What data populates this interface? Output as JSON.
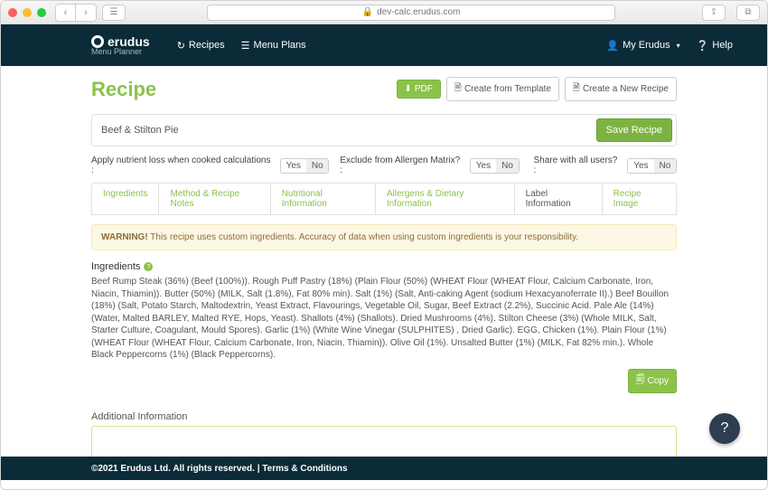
{
  "browser": {
    "url": "dev-calc.erudus.com"
  },
  "header": {
    "brand": "erudus",
    "sub": "Menu Planner",
    "nav": {
      "recipes": "Recipes",
      "menu_plans": "Menu Plans"
    },
    "user_menu": "My Erudus",
    "help": "Help"
  },
  "page": {
    "title": "Recipe",
    "actions": {
      "pdf": "PDF",
      "from_template": "Create from Template",
      "new_recipe": "Create a New Recipe"
    },
    "recipe_name": "Beef & Stilton Pie",
    "save_label": "Save Recipe",
    "options": {
      "nutrient_loss_label": "Apply nutrient loss when cooked calculations :",
      "exclude_allergen_label": "Exclude from Allergen Matrix? :",
      "share_label": "Share with all users? :",
      "yes": "Yes",
      "no": "No"
    },
    "tabs": [
      "Ingredients",
      "Method & Recipe Notes",
      "Nutritional Information",
      "Allergens & Dietary Information",
      "Label Information",
      "Recipe Image"
    ],
    "active_tab_index": 4,
    "warning_prefix": "WARNING!",
    "warning_text": " This recipe uses custom ingredients. Accuracy of data when using custom ingredients is your responsibility.",
    "ingredients_title": "Ingredients",
    "ingredients_text": "Beef Rump Steak (36%) (Beef (100%)). Rough Puff Pastry (18%) (Plain Flour (50%) (WHEAT Flour (WHEAT Flour, Calcium Carbonate, Iron, Niacin, Thiamin)). Butter (50%) (MILK, Salt (1.8%), Fat 80% min). Salt (1%) (Salt, Anti-caking Agent (sodium Hexacyanoferrate II).) Beef Bouillon (18%) (Salt, Potato Starch, Maltodextrin, Yeast Extract, Flavourings, Vegetable Oil, Sugar, Beef Extract (2.2%), Succinic Acid. Pale Ale (14%) (Water, Malted BARLEY, Malted RYE, Hops, Yeast). Shallots (4%) (Shallots). Dried Mushrooms (4%). Stilton Cheese (3%) (Whole MILK, Salt, Starter Culture, Coagulant, Mould Spores). Garlic (1%) (White Wine Vinegar (SULPHITES) , Dried Garlic). EGG, Chicken (1%). Plain Flour (1%) (WHEAT Flour (WHEAT Flour, Calcium Carbonate, Iron, Niacin, Thiamin)). Olive Oil (1%). Unsalted Butter (1%) (MILK, Fat 82% min.). Whole Black Peppercorns (1%) (Black Peppercorns).",
    "copy_label": "Copy",
    "addl_title": "Additional Information",
    "addl_value": ""
  },
  "footer": {
    "copyright": "©2021 Erudus Ltd. All rights reserved. |",
    "terms": " Terms & Conditions"
  }
}
